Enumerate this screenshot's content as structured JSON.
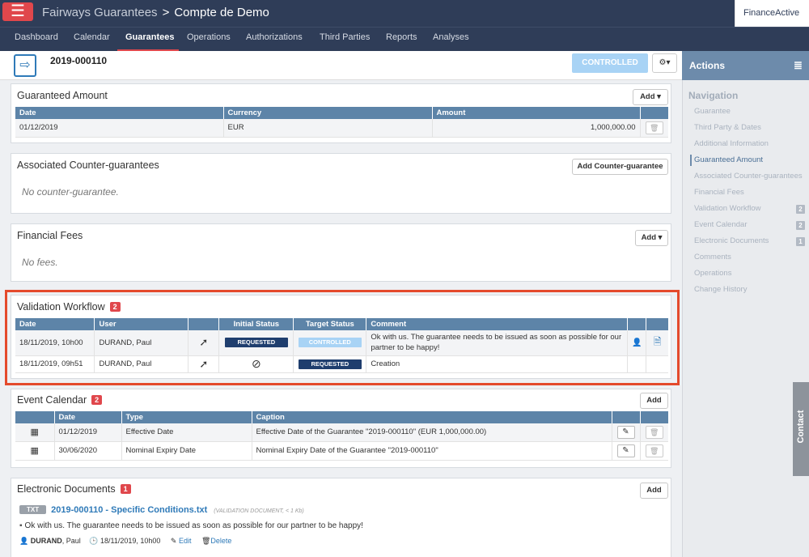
{
  "header": {
    "app_name": "Fairways Guarantees",
    "separator": ">",
    "account": "Compte de Demo",
    "logo": "FinanceActive",
    "menu_icon": "hamburger-icon"
  },
  "nav": {
    "items": [
      "Dashboard",
      "Calendar",
      "Guarantees",
      "Operations",
      "Authorizations",
      "Third Parties",
      "Reports",
      "Analyses"
    ],
    "active": "Guarantees"
  },
  "record": {
    "id": "2019-000110",
    "status": "CONTROLLED",
    "status_color": "#a8d3f5",
    "tools_label": "⚙▾"
  },
  "guaranteed_amount": {
    "title": "Guaranteed Amount",
    "add_label": "Add ▾",
    "columns": [
      "Date",
      "Currency",
      "Amount"
    ],
    "rows": [
      {
        "date": "01/12/2019",
        "currency": "EUR",
        "amount": "1,000,000.00"
      }
    ]
  },
  "counter_guarantees": {
    "title": "Associated Counter-guarantees",
    "add_label": "Add Counter-guarantee",
    "empty": "No counter-guarantee."
  },
  "financial_fees": {
    "title": "Financial Fees",
    "add_label": "Add ▾",
    "empty": "No fees."
  },
  "validation_workflow": {
    "title": "Validation Workflow",
    "count": "2",
    "columns": [
      "Date",
      "User",
      "",
      "Initial Status",
      "Target Status",
      "Comment"
    ],
    "rows": [
      {
        "date": "18/11/2019, 10h00",
        "user": "DURAND, Paul",
        "initial": "REQUESTED",
        "target": "CONTROLLED",
        "comment": "Ok with us. The guarantee needs to be issued as soon as possible for our partner to be happy!"
      },
      {
        "date": "18/11/2019, 09h51",
        "user": "DURAND, Paul",
        "initial": "",
        "target": "REQUESTED",
        "comment": "Creation"
      }
    ]
  },
  "event_calendar": {
    "title": "Event Calendar",
    "count": "2",
    "add_label": "Add",
    "columns": [
      "Date",
      "Type",
      "Caption"
    ],
    "rows": [
      {
        "date": "01/12/2019",
        "type": "Effective Date",
        "caption": "Effective Date of the Guarantee \"2019-000110\" (EUR 1,000,000.00)"
      },
      {
        "date": "30/06/2020",
        "type": "Nominal Expiry Date",
        "caption": "Nominal Expiry Date of the Guarantee \"2019-000110\""
      }
    ]
  },
  "electronic_documents": {
    "title": "Electronic Documents",
    "count": "1",
    "add_label": "Add",
    "doc": {
      "type": "TXT",
      "name": "2019-000110 - Specific Conditions.txt",
      "meta": "(VALIDATION DOCUMENT, < 1 Kb)",
      "comment": "Ok with us. The guarantee needs to be issued as soon as possible for our partner to be happy!",
      "author": "DURAND",
      "author_first": ", Paul",
      "date": "18/11/2019, 10h00",
      "edit_label": "Edit",
      "delete_label": "Delete"
    }
  },
  "sidebar": {
    "header": "Actions",
    "nav_title": "Navigation",
    "items": [
      {
        "label": "Guarantee",
        "count": ""
      },
      {
        "label": "Third Party & Dates",
        "count": ""
      },
      {
        "label": "Additional Information",
        "count": ""
      },
      {
        "label": "Guaranteed Amount",
        "count": ""
      },
      {
        "label": "Associated Counter-guarantees",
        "count": ""
      },
      {
        "label": "Financial Fees",
        "count": ""
      },
      {
        "label": "Validation Workflow",
        "count": "2"
      },
      {
        "label": "Event Calendar",
        "count": "2"
      },
      {
        "label": "Electronic Documents",
        "count": "1"
      },
      {
        "label": "Comments",
        "count": ""
      },
      {
        "label": "Operations",
        "count": ""
      },
      {
        "label": "Change History",
        "count": ""
      }
    ],
    "active": "Guaranteed Amount",
    "contact": "Contact"
  }
}
